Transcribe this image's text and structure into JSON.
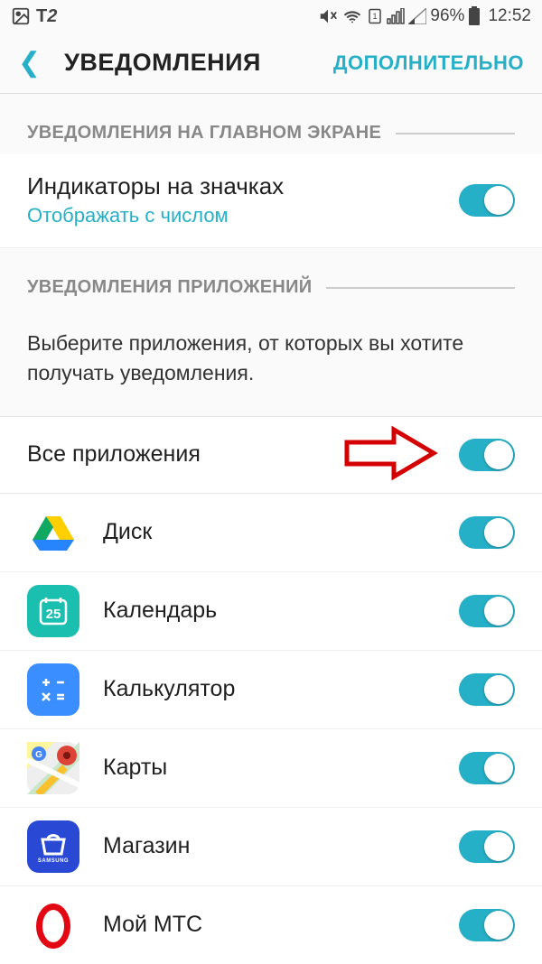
{
  "status_bar": {
    "carrier_prefix": "T",
    "carrier": "2",
    "battery_percent": "96%",
    "time": "12:52"
  },
  "header": {
    "title": "УВЕДОМЛЕНИЯ",
    "action": "ДОПОЛНИТЕЛЬНО"
  },
  "section1": {
    "title": "УВЕДОМЛЕНИЯ НА ГЛАВНОМ ЭКРАНЕ",
    "row": {
      "title": "Индикаторы на значках",
      "subtitle": "Отображать с числом"
    }
  },
  "section2": {
    "title": "УВЕДОМЛЕНИЯ ПРИЛОЖЕНИЙ",
    "description": "Выберите приложения, от которых вы хотите получать уведомления.",
    "all_apps": "Все приложения"
  },
  "apps": [
    {
      "name": "Диск"
    },
    {
      "name": "Календарь"
    },
    {
      "name": "Калькулятор"
    },
    {
      "name": "Карты"
    },
    {
      "name": "Магазин"
    },
    {
      "name": "Мой МТС"
    }
  ]
}
